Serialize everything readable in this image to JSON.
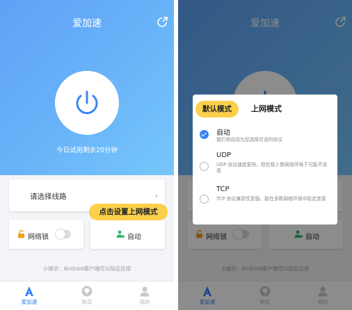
{
  "app": {
    "title": "爱加速"
  },
  "home": {
    "trial_text": "今日试用剩余20分钟",
    "route_label": "请选择线路",
    "net_lock_label": "网络锁",
    "mode_label": "自动",
    "tip": "小提示：Android客户端可以指定应用"
  },
  "tabs": [
    {
      "label": "爱加速",
      "icon": "a-logo-icon"
    },
    {
      "label": "购买",
      "icon": "diamond-icon"
    },
    {
      "label": "我的",
      "icon": "user-icon"
    }
  ],
  "callouts": {
    "left": "点击设置上网模式",
    "right": "默认模式"
  },
  "dialog": {
    "title": "上网模式",
    "options": [
      {
        "name": "自动",
        "desc": "我们将自动为您选择合适的协议",
        "checked": true
      },
      {
        "name": "UDP",
        "desc": "UDP 协议速度更快，但在极少数网络环境下可能不适用",
        "checked": false
      },
      {
        "name": "TCP",
        "desc": "TCP 协议兼容性更强，能在多数网络环境中稳定连接",
        "checked": false
      }
    ]
  },
  "colors": {
    "brand": "#2f7cf6",
    "callout": "#fbd04a",
    "gradient_start": "#5fa1f5",
    "gradient_end": "#76c6fb"
  }
}
